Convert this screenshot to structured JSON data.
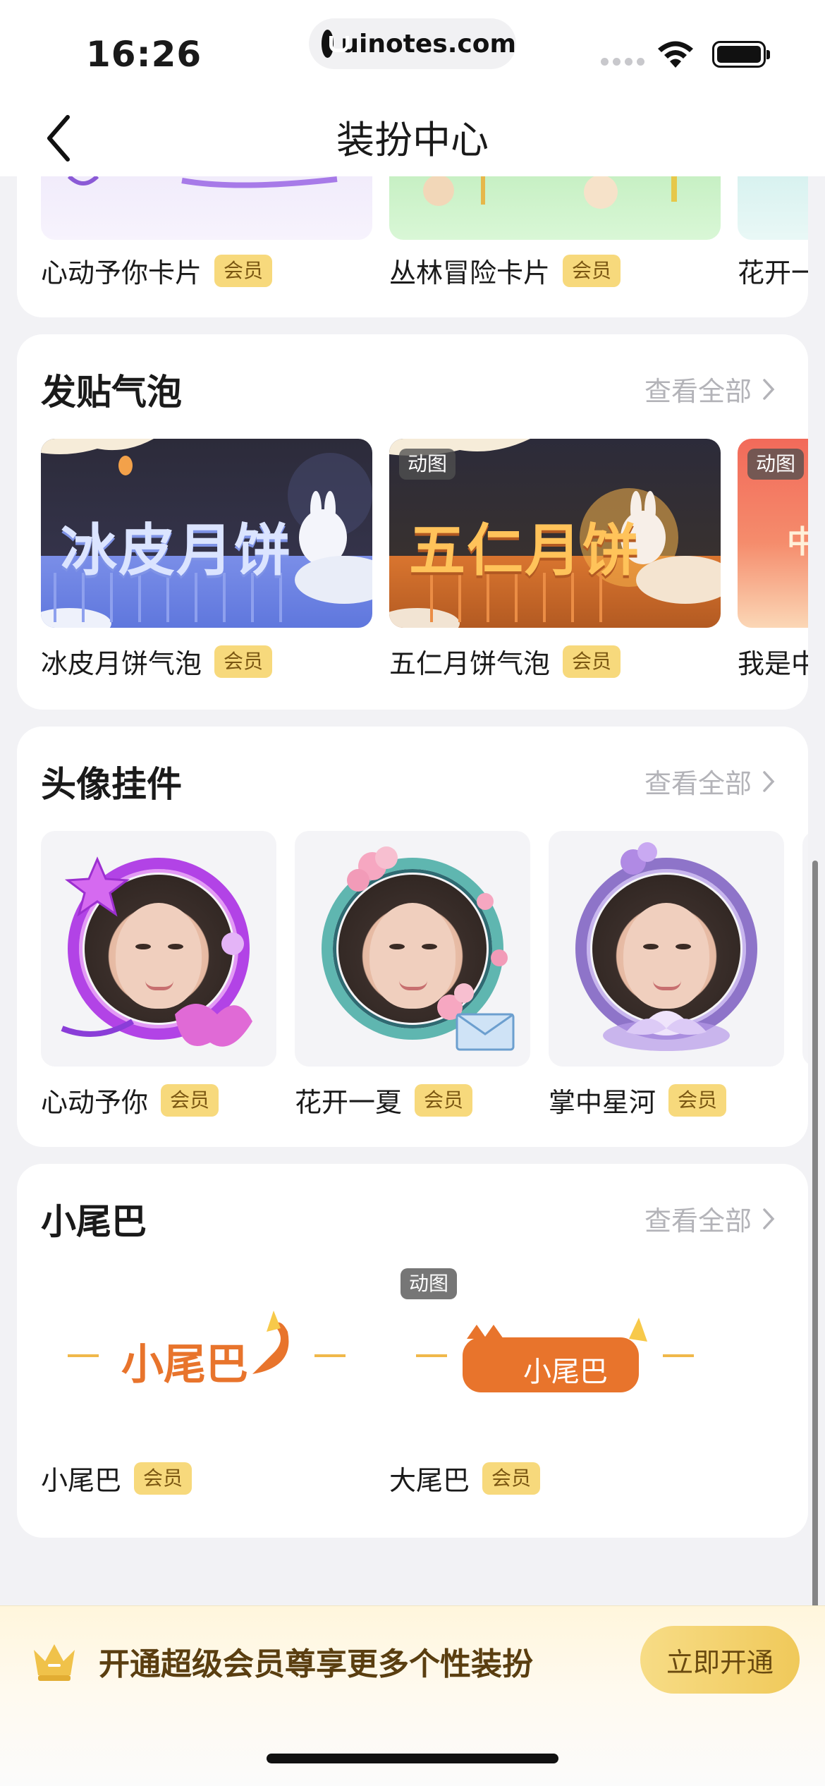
{
  "status_bar": {
    "time": "16:26",
    "url": "uinotes.com"
  },
  "nav": {
    "title": "装扮中心"
  },
  "cards_section": {
    "items": [
      {
        "label": "心动予你卡片",
        "badge": "会员"
      },
      {
        "label": "丛林冒险卡片",
        "badge": "会员"
      },
      {
        "label": "花开一"
      }
    ]
  },
  "bubble_section": {
    "title": "发贴气泡",
    "view_all": "查看全部",
    "items": [
      {
        "art_text": "冰皮月饼",
        "label": "冰皮月饼气泡",
        "badge": "会员"
      },
      {
        "art_text": "五仁月饼",
        "label": "五仁月饼气泡",
        "badge": "会员",
        "tag": "动图"
      },
      {
        "label": "我是中",
        "tag": "动图",
        "art_text": "中"
      }
    ]
  },
  "avatar_section": {
    "title": "头像挂件",
    "view_all": "查看全部",
    "items": [
      {
        "label": "心动予你",
        "badge": "会员"
      },
      {
        "label": "花开一夏",
        "badge": "会员"
      },
      {
        "label": "掌中星河",
        "badge": "会员"
      }
    ]
  },
  "tail_section": {
    "title": "小尾巴",
    "view_all": "查看全部",
    "items": [
      {
        "art_text": "小尾巴",
        "label": "小尾巴",
        "badge": "会员"
      },
      {
        "art_text": "小尾巴",
        "label": "大尾巴",
        "badge": "会员",
        "tag": "动图"
      }
    ]
  },
  "vip_bar": {
    "text": "开通超级会员尊享更多个性装扮",
    "button": "立即开通"
  },
  "colors": {
    "accent_gold": "#f7d97c",
    "page_bg": "#f2f2f5",
    "tail_orange": "#e8742c"
  }
}
